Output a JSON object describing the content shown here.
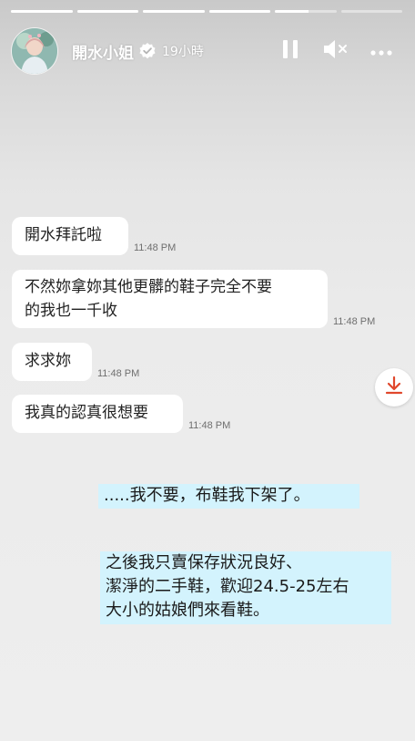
{
  "story": {
    "progress": [
      1,
      1,
      1,
      1,
      0.55,
      0
    ],
    "user": {
      "name": "開水小姐",
      "verified": true,
      "time_ago": "19小時"
    },
    "controls": {
      "pause_icon": "pause-icon",
      "mute_icon": "speaker-muted-icon",
      "more_icon": "more-horizontal-icon"
    }
  },
  "chat": {
    "messages": [
      {
        "text": "開水拜託啦",
        "time": "11:48 PM"
      },
      {
        "text": "不然妳拿妳其他更髒的鞋子完全不要的我也一千收",
        "line1": "不然妳拿妳其他更髒的鞋子完全不要",
        "line2": "的我也一千收",
        "time": "11:48 PM"
      },
      {
        "text": "求求妳",
        "time": "11:48 PM"
      },
      {
        "text": "我真的認真很想要",
        "time": "11:48 PM"
      }
    ],
    "download_icon": "download-arrow-icon",
    "download_color": "#e0472c"
  },
  "captions": {
    "first": ".....我不要，布鞋我下架了。",
    "second_line1": "之後我只賣保存狀況良好、",
    "second_line2": "潔淨的二手鞋，歡迎24.5-25左右",
    "second_line3": "大小的姑娘們來看鞋。",
    "highlight_color": "#d3f3fd"
  }
}
